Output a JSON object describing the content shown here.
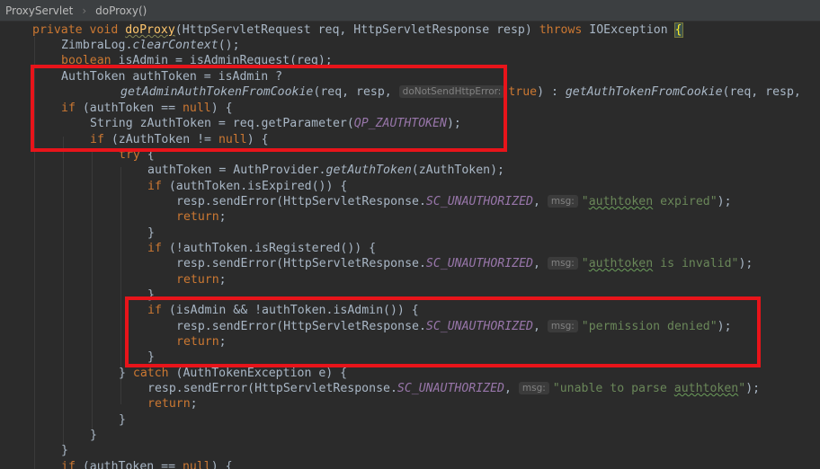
{
  "breadcrumb": {
    "class_name": "ProxyServlet",
    "separator": "›",
    "method_name": "doProxy()"
  },
  "code": {
    "l1": {
      "kw": "private void ",
      "method": "doProxy",
      "rest": "(HttpServletRequest req, HttpServletResponse resp) ",
      "throws": "throws",
      "exc": " IOException ",
      "brace": "{"
    },
    "l2": {
      "cls": "ZimbraLog.",
      "call": "clearContext",
      "rest": "();"
    },
    "l3": {
      "kw": "boolean",
      "rest": " isAdmin = isAdminRequest(req);"
    },
    "l4": {
      "text": "AuthToken authToken = isAdmin ?"
    },
    "l5": {
      "call": "getAdminAuthTokenFromCookie",
      "args": "(req, resp, ",
      "hint": "doNotSendHttpError:",
      "val": "true",
      "mid": ") : ",
      "call2": "getAuthTokenFromCookie",
      "rest": "(req, resp,"
    },
    "l6": {
      "kw": "if",
      "mid": " (authToken == ",
      "nul": "null",
      "rest": ") {"
    },
    "l7": {
      "text": "String zAuthToken = req.getParameter(",
      "cst": "QP_ZAUTHTOKEN",
      "rest": ");"
    },
    "l8": {
      "kw": "if",
      "mid": " (zAuthToken != ",
      "nul": "null",
      "rest": ") {"
    },
    "l9": {
      "kw": "try",
      "rest": " {"
    },
    "l10": {
      "text": "authToken = AuthProvider.",
      "call": "getAuthToken",
      "rest": "(zAuthToken);"
    },
    "l11": {
      "kw": "if",
      "rest": " (authToken.isExpired()) {"
    },
    "l12": {
      "text": "resp.sendError(HttpServletResponse.",
      "cst": "SC_UNAUTHORIZED",
      "comma": ", ",
      "hint": "msg:",
      "q1": "\"",
      "ul": "authtoken",
      "tail": " expired\"",
      "rest": ");"
    },
    "l13": {
      "kw": "return",
      "rest": ";"
    },
    "l14": {
      "text": "}"
    },
    "l15": {
      "kw": "if",
      "rest": " (!authToken.isRegistered()) {"
    },
    "l16": {
      "text": "resp.sendError(HttpServletResponse.",
      "cst": "SC_UNAUTHORIZED",
      "comma": ", ",
      "hint": "msg:",
      "q1": "\"",
      "ul": "authtoken",
      "tail": " is invalid\"",
      "rest": ");"
    },
    "l17": {
      "kw": "return",
      "rest": ";"
    },
    "l18": {
      "text": "}"
    },
    "l19": {
      "kw": "if",
      "rest": " (isAdmin && !authToken.isAdmin()) {"
    },
    "l20": {
      "text": "resp.sendError(HttpServletResponse.",
      "cst": "SC_UNAUTHORIZED",
      "comma": ", ",
      "hint": "msg:",
      "str": "\"permission denied\"",
      "rest": ");"
    },
    "l21": {
      "kw": "return",
      "rest": ";"
    },
    "l22": {
      "text": "}"
    },
    "l23": {
      "brace": "} ",
      "kw": "catch",
      "rest": " (AuthTokenException e) {"
    },
    "l24": {
      "text": "resp.sendError(HttpServletResponse.",
      "cst": "SC_UNAUTHORIZED",
      "comma": ", ",
      "hint": "msg:",
      "q1": "\"unable to parse ",
      "ul": "authtoken",
      "tail": "\"",
      "rest": ");"
    },
    "l25": {
      "kw": "return",
      "rest": ";"
    },
    "l26": {
      "text": "}"
    },
    "l27": {
      "text": "}"
    },
    "l28": {
      "text": "}"
    },
    "l29": {
      "kw": "if",
      "mid": " (authToken == ",
      "nul": "null",
      "rest": ") {"
    }
  },
  "colors": {
    "highlight_box": "#e8141a",
    "background": "#2b2b2b",
    "keyword": "#cc7832",
    "string": "#6a8759",
    "constant": "#9876aa",
    "method": "#ffc66d"
  }
}
